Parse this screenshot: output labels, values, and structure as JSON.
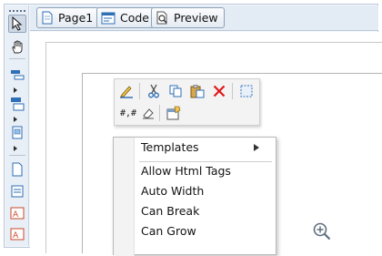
{
  "tabs": [
    {
      "label": "Page1",
      "icon": "page-icon"
    },
    {
      "label": "Code",
      "icon": "code-icon"
    },
    {
      "label": "Preview",
      "icon": "preview-icon"
    }
  ],
  "toolbox": {
    "tools": [
      "pointer-icon",
      "hand-icon",
      "report-header-icon",
      "group-icon",
      "section-icon",
      "textbox-icon",
      "textbox-icon",
      "label-icon",
      "label-icon"
    ]
  },
  "mini_toolbar": {
    "row1": [
      "edit-pencil-icon",
      "cut-icon",
      "copy-icon",
      "paste-icon",
      "delete-icon",
      "select-all-icon"
    ],
    "row2": [
      "format-icon",
      "eraser-icon",
      "properties-icon"
    ],
    "format_text": "#,#"
  },
  "context_menu": {
    "submenu_item": "Templates",
    "items": [
      "Allow Html Tags",
      "Auto Width",
      "Can Break",
      "Can Grow"
    ]
  },
  "colors": {
    "delete": "#e01818",
    "accent": "#2f6fb6",
    "menu_border": "#b9b9b9"
  }
}
